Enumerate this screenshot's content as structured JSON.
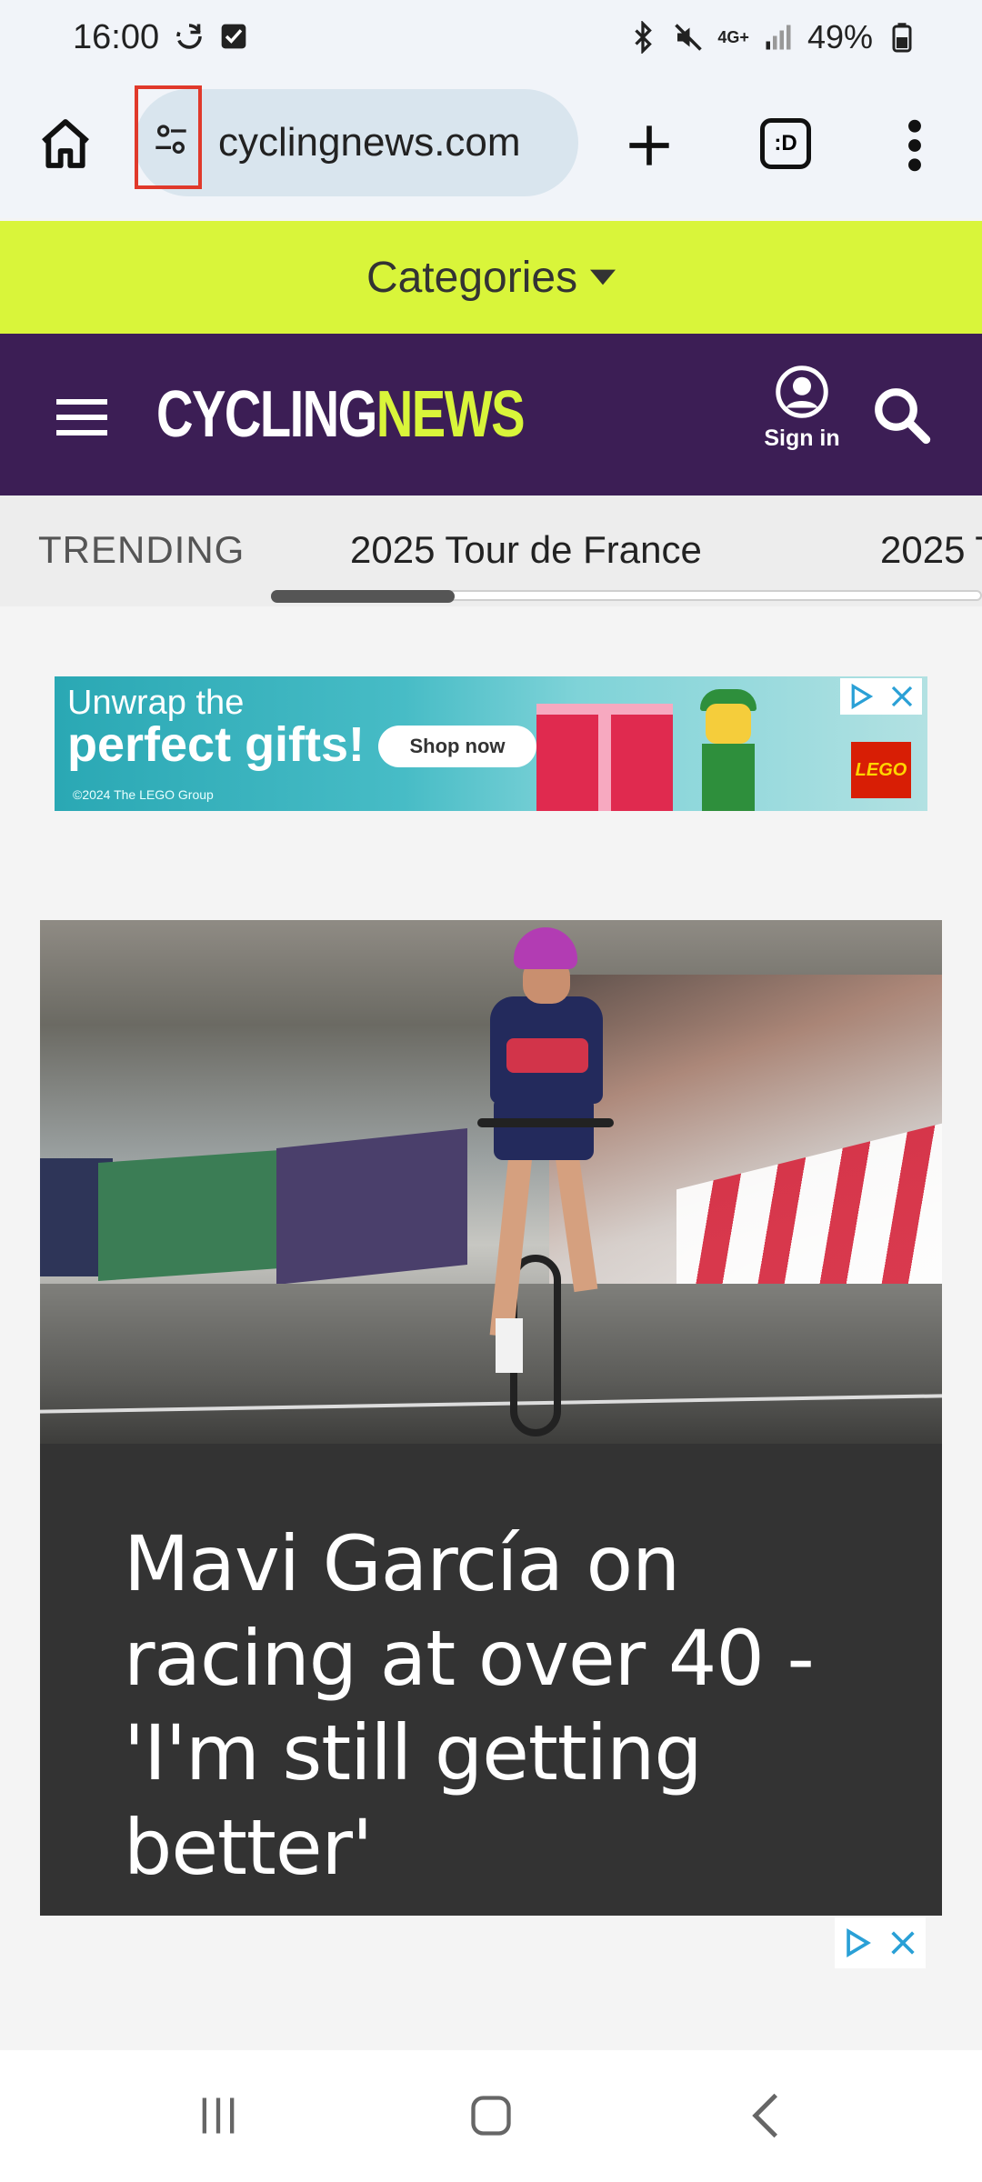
{
  "status_bar": {
    "time": "16:00",
    "network": "4G+",
    "battery": "49%",
    "icons": [
      "sync-icon",
      "checkbox-icon",
      "bluetooth-icon",
      "mute-icon",
      "network-4g-icon",
      "signal-icon",
      "battery-icon"
    ]
  },
  "browser": {
    "url": "cyclingnews.com",
    "tabs_label": ":D"
  },
  "categories": {
    "label": "Categories"
  },
  "header": {
    "logo_part1": "CYCLING",
    "logo_part2": "NEWS",
    "signin_label": "Sign in",
    "bg_color": "#3c1e55",
    "accent_color": "#d9f53a"
  },
  "trending": {
    "label": "TRENDING",
    "items": [
      "2025 Tour de France",
      "2025 T"
    ]
  },
  "ad": {
    "line1": "Unwrap the",
    "line2": "perfect gifts!",
    "cta": "Shop now",
    "copyright": "©2024 The LEGO Group",
    "brand": "LEGO"
  },
  "article": {
    "title": "Mavi García on racing at over 40 - 'I'm still getting better'"
  }
}
